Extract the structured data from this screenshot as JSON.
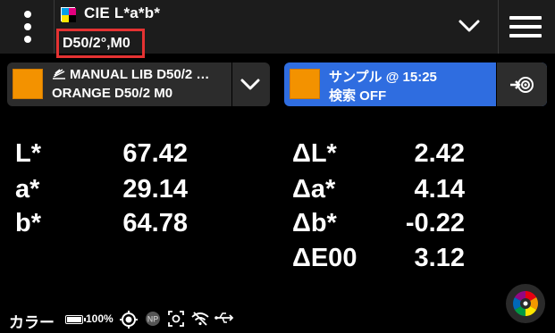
{
  "topbar": {
    "mode_title": "CIE L*a*b*",
    "illuminant_observer": "D50/2°,M0",
    "mode_icon": "cmyk-squares-icon",
    "menu_icon": "kebab-menu-icon",
    "dropdown_icon": "chevron-down-icon",
    "main_menu_icon": "hamburger-icon"
  },
  "standard_panel": {
    "line1": "MANUAL LIB D50/2 …",
    "line2": "ORANGE D50/2 M0",
    "swatch_color": "#f39200",
    "library_icon": "library-icon",
    "chevron_icon": "chevron-down-icon"
  },
  "sample_panel": {
    "line1": "サンプル @ 15:25",
    "line2": "検索 OFF",
    "swatch_color": "#f39200",
    "accent_color": "#2f6de0",
    "measure_icon": "measure-target-icon"
  },
  "values": {
    "absolute": [
      {
        "label": "L*",
        "value": "67.42"
      },
      {
        "label": "a*",
        "value": "29.14"
      },
      {
        "label": "b*",
        "value": "64.78"
      }
    ],
    "delta": [
      {
        "label": "ΔL*",
        "value": "2.42"
      },
      {
        "label": "Δa*",
        "value": "4.14"
      },
      {
        "label": "Δb*",
        "value": "-0.22"
      },
      {
        "label": "ΔE00",
        "value": "3.12"
      }
    ]
  },
  "status": {
    "label": "カラー",
    "battery": "100%",
    "icons": [
      "target-icon",
      "np-icon",
      "camera-focus-icon",
      "wifi-off-icon",
      "usb-icon"
    ],
    "color_wheel_icon": "color-wheel-icon"
  }
}
